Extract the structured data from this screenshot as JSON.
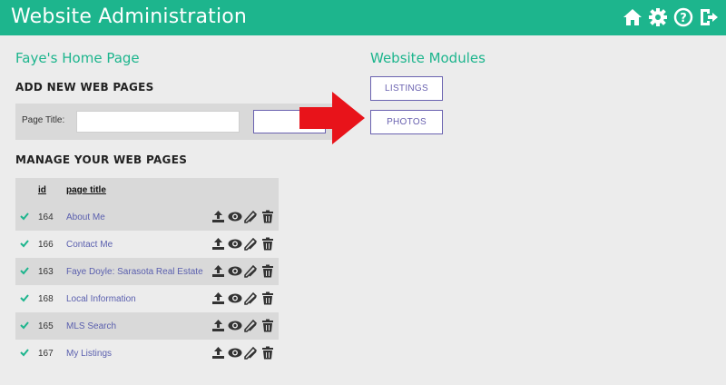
{
  "header": {
    "title": "Website Administration",
    "icons": [
      "home-icon",
      "gear-icon",
      "help-icon",
      "logout-icon"
    ],
    "color": "#1db58d"
  },
  "home": {
    "heading": "Faye's Home Page"
  },
  "add_pages": {
    "heading": "ADD NEW WEB PAGES",
    "label": "Page Title:",
    "input_value": "",
    "button_label": ""
  },
  "manage": {
    "heading": "MANAGE YOUR WEB PAGES",
    "columns": [
      "id",
      "page title"
    ],
    "rows": [
      {
        "id": "164",
        "title": "About Me"
      },
      {
        "id": "166",
        "title": "Contact Me"
      },
      {
        "id": "163",
        "title": "Faye Doyle: Sarasota Real Estate"
      },
      {
        "id": "168",
        "title": "Local Information"
      },
      {
        "id": "165",
        "title": "MLS Search"
      },
      {
        "id": "167",
        "title": "My Listings"
      }
    ],
    "row_actions": [
      "upload-icon",
      "view-icon",
      "edit-icon",
      "delete-icon"
    ]
  },
  "modules": {
    "heading": "Website Modules",
    "buttons": [
      "LISTINGS",
      "PHOTOS"
    ]
  },
  "colors": {
    "accent": "#1db58d",
    "link": "#5a5fae",
    "button_border": "#6a62b0",
    "arrow": "#e8131a"
  }
}
